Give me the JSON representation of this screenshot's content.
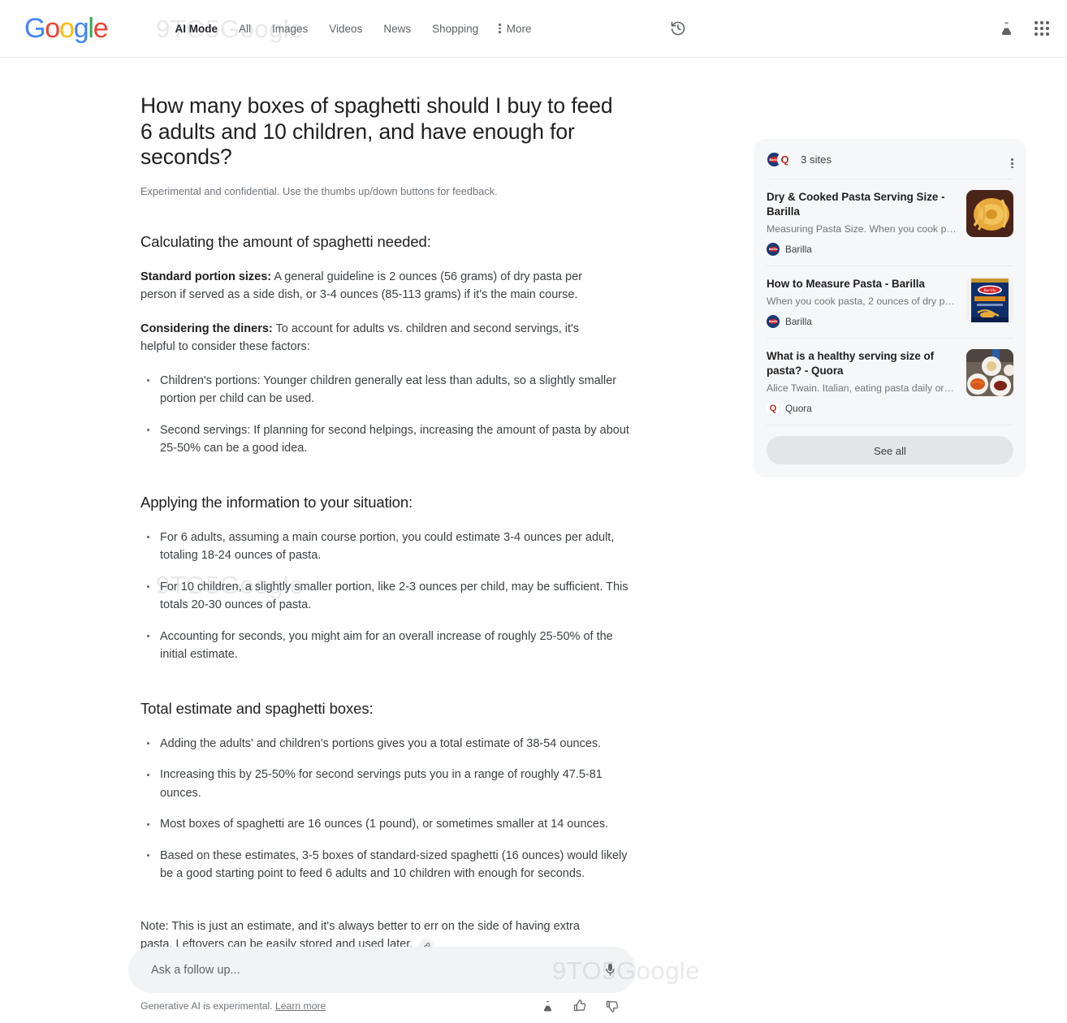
{
  "brand": {
    "logo_letters": [
      "G",
      "o",
      "o",
      "g",
      "l",
      "e"
    ]
  },
  "header": {
    "nav": [
      {
        "label": "AI Mode",
        "active": true
      },
      {
        "label": "All",
        "active": false
      },
      {
        "label": "Images",
        "active": false
      },
      {
        "label": "Videos",
        "active": false
      },
      {
        "label": "News",
        "active": false
      },
      {
        "label": "Shopping",
        "active": false
      }
    ],
    "more_label": "More",
    "icons": {
      "history": "history-icon",
      "labs": "labs-flask-icon",
      "apps": "apps-grid-icon",
      "more_dots": "more-vert-icon"
    }
  },
  "main": {
    "question": "How many boxes of spaghetti should I buy to feed 6 adults and 10 children, and have enough for seconds?",
    "disclaimer": "Experimental and confidential. Use the thumbs up/down buttons for feedback.",
    "sections": [
      {
        "heading": "Calculating the amount of spaghetti needed:",
        "paragraphs": [
          {
            "lead": "Standard portion sizes:",
            "text": " A general guideline is 2 ounces (56 grams) of dry pasta per person if served as a side dish, or 3-4 ounces (85-113 grams) if it's the main course."
          },
          {
            "lead": "Considering the diners:",
            "text": " To account for adults vs. children and second servings, it's helpful to consider these factors:"
          }
        ],
        "bullets": [
          "Children's portions: Younger children generally eat less than adults, so a slightly smaller portion per child can be used.",
          "Second servings: If planning for second helpings, increasing the amount of pasta by about 25-50% can be a good idea."
        ]
      },
      {
        "heading": "Applying the information to your situation:",
        "paragraphs": [],
        "bullets": [
          "For 6 adults, assuming a main course portion, you could estimate 3-4 ounces per adult, totaling 18-24 ounces of pasta.",
          "For 10 children, a slightly smaller portion, like 2-3 ounces per child, may be sufficient. This totals 20-30 ounces of pasta.",
          "Accounting for seconds, you might aim for an overall increase of roughly 25-50% of the initial estimate."
        ]
      },
      {
        "heading": "Total estimate and spaghetti boxes:",
        "paragraphs": [],
        "bullets": [
          "Adding the adults' and children's portions gives you a total estimate of 38-54 ounces.",
          "Increasing this by 25-50% for second servings puts you in a range of roughly 47.5-81 ounces.",
          "Most boxes of spaghetti are 16 ounces (1 pound), or sometimes smaller at 14 ounces.",
          "Based on these estimates, 3-5 boxes of standard-sized spaghetti (16 ounces) would likely be a good starting point to feed 6 adults and 10 children with enough for seconds."
        ]
      }
    ],
    "note": "Note: This is just an estimate, and it's always better to err on the side of having extra pasta. Leftovers can be easily stored and used later.",
    "footer": {
      "gen_note": "Generative AI is experimental.",
      "learn_more": "Learn more",
      "icons": {
        "labs": "labs-flask-icon",
        "thumbs_up": "thumb-up-icon",
        "thumbs_down": "thumb-down-icon"
      }
    }
  },
  "sources": {
    "count_label": "3 sites",
    "see_all_label": "See all",
    "items": [
      {
        "title": "Dry & Cooked Pasta Serving Size - Barilla",
        "snippet": "Measuring Pasta Size. When you cook past...",
        "publisher": "Barilla",
        "favicon": "barilla-favicon",
        "thumb": "pasta-nest-thumbnail"
      },
      {
        "title": "How to Measure Pasta - Barilla",
        "snippet": "When you cook pasta, 2 ounces of dry past...",
        "publisher": "Barilla",
        "favicon": "barilla-favicon",
        "thumb": "barilla-box-thumbnail"
      },
      {
        "title": "What is a healthy serving size of pasta? - Quora",
        "snippet": "Alice Twain. Italian, eating pasta daily or so....",
        "publisher": "Quora",
        "favicon": "quora-favicon",
        "thumb": "pasta-plates-thumbnail"
      }
    ]
  },
  "followup": {
    "placeholder": "Ask a follow up...",
    "value": "",
    "mic_icon": "microphone-icon"
  },
  "watermark": {
    "text": "9TO5Google"
  },
  "colors": {
    "google_blue": "#4285F4",
    "google_red": "#EA4335",
    "google_yellow": "#FBBC05",
    "google_green": "#34A853",
    "card_bg": "#f6f7f9",
    "see_all_bg": "#e3e5e8",
    "followup_bg": "#f1f3f4"
  }
}
